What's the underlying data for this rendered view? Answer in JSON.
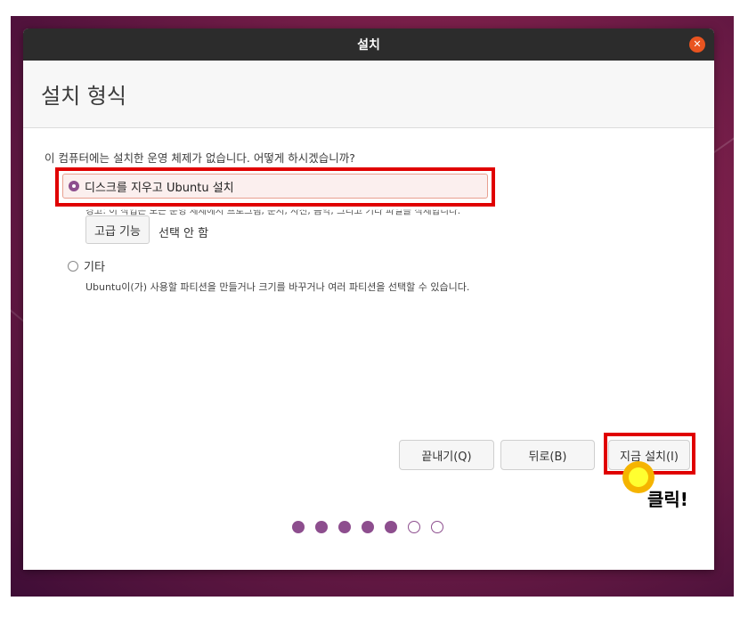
{
  "window": {
    "title": "설치"
  },
  "header": {
    "title": "설치 형식"
  },
  "question": "이 컴퓨터에는 설치한 운영 체제가 없습니다. 어떻게 하시겠습니까?",
  "options": [
    {
      "label": "디스크를 지우고 Ubuntu 설치",
      "checked": true,
      "description": "경고: 이 작업은 모든 운영 체제에서 프로그램, 문서, 사진, 음악, 그리고 기타 파일을 삭제합니다."
    },
    {
      "label": "기타",
      "checked": false,
      "description": "Ubuntu이(가) 사용할 파티션을 만들거나 크기를 바꾸거나 여러 파티션을 선택할 수 있습니다."
    }
  ],
  "advanced": {
    "button_label": "고급 기능",
    "value": "선택 안 함"
  },
  "buttons": {
    "quit": "끝내기(Q)",
    "back": "뒤로(B)",
    "install": "지금 설치(I)"
  },
  "progress": {
    "total_steps": 7,
    "completed_steps": 5
  },
  "annotation": {
    "label": "클릭!"
  },
  "colors": {
    "accent": "#8d4e8e",
    "close": "#e95420",
    "highlight": "#e00000"
  }
}
